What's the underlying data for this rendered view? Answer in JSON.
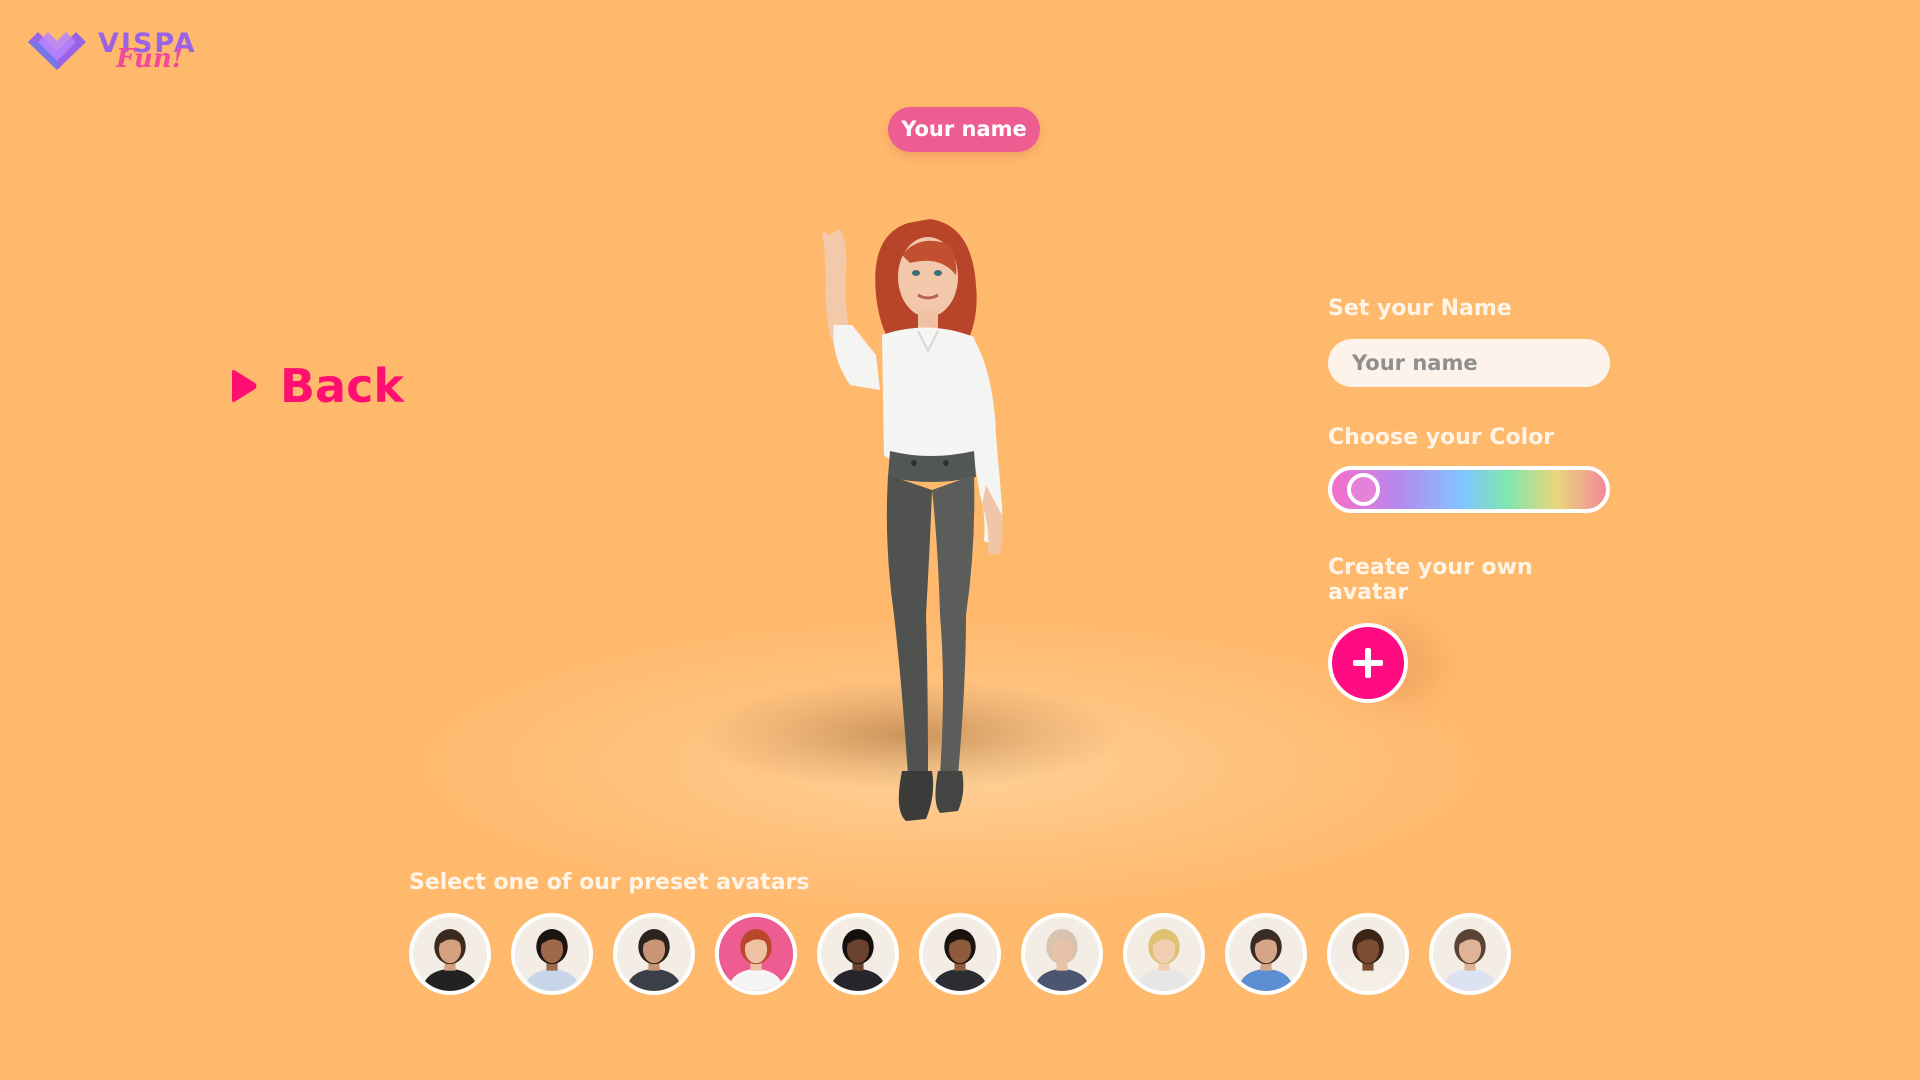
{
  "brand": {
    "name": "VISPA",
    "tagline": "Fun!"
  },
  "avatar": {
    "name_tag": "Your name"
  },
  "navigation": {
    "back_label": "Back"
  },
  "settings": {
    "name_label": "Set your Name",
    "name_input_placeholder": "Your name",
    "name_input_value": "",
    "color_label": "Choose your Color",
    "color_value": 0.05,
    "create_label": "Create your own avatar"
  },
  "presets": {
    "label": "Select one of our preset avatars",
    "selected_index": 3,
    "items": [
      {
        "hair": "#3b2a20",
        "skin": "#d4a07e",
        "shirt": "#222222",
        "bg": "#f3ede6"
      },
      {
        "hair": "#1b1412",
        "skin": "#9c6a4a",
        "shirt": "#c8d6ea",
        "bg": "#f3ede6"
      },
      {
        "hair": "#2a2320",
        "skin": "#c99574",
        "shirt": "#3b4048",
        "bg": "#f3ede6"
      },
      {
        "hair": "#b9472c",
        "skin": "#efc2a4",
        "shirt": "#f5f5f5",
        "bg": "#ee5d92"
      },
      {
        "hair": "#141010",
        "skin": "#6a4330",
        "shirt": "#24262b",
        "bg": "#f3ede6"
      },
      {
        "hair": "#1a1310",
        "skin": "#8e5a3c",
        "shirt": "#2c2c33",
        "bg": "#f3ede6"
      },
      {
        "hair": "#d8c3ae",
        "skin": "#e8c2a8",
        "shirt": "#4b5670",
        "bg": "#f3ede6"
      },
      {
        "hair": "#e0c173",
        "skin": "#f1cdb2",
        "shirt": "#e6e6e6",
        "bg": "#f3ede6"
      },
      {
        "hair": "#3a2c25",
        "skin": "#d6a587",
        "shirt": "#5b8fd3",
        "bg": "#f3ede6"
      },
      {
        "hair": "#3d2416",
        "skin": "#7c4d33",
        "shirt": "#f5efe6",
        "bg": "#f3ede6"
      },
      {
        "hair": "#5a4234",
        "skin": "#dfb396",
        "shirt": "#dbe3f2",
        "bg": "#f3ede6"
      }
    ]
  }
}
